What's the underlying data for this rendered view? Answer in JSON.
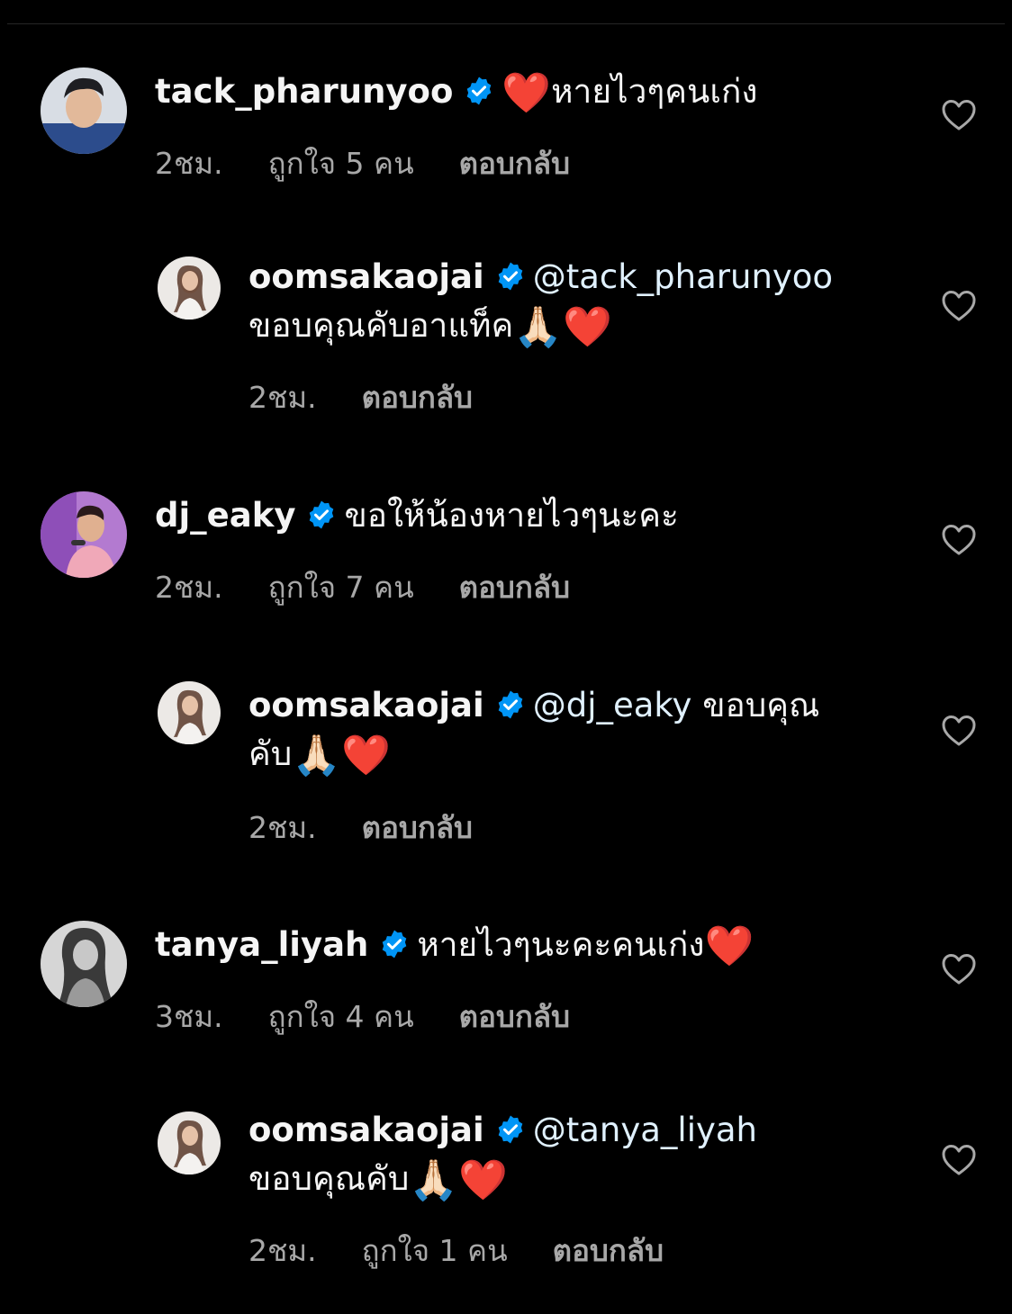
{
  "colors": {
    "background": "#000000",
    "text": "#f5f5f5",
    "muted": "#a8a8a8",
    "mention": "#e0f1ff",
    "verified": "#0095f6",
    "heart": "#e0162b"
  },
  "comments": [
    {
      "username": "tack_pharunyoo",
      "verified": true,
      "emoji_before": "❤️",
      "text": "หายไวๆคนเก่ง",
      "time": "2ชม.",
      "likes": "ถูกใจ 5 คน",
      "reply_label": "ตอบกลับ",
      "icon": "heart-outline-icon"
    },
    {
      "username": "oomsakaojai",
      "verified": true,
      "mention": "@tack_pharunyoo",
      "text": "ขอบคุณคับอาแท็ค",
      "emoji_after": "🙏🏻",
      "heart_after": "❤️",
      "time": "2ชม.",
      "reply_label": "ตอบกลับ",
      "icon": "heart-outline-icon"
    },
    {
      "username": "dj_eaky",
      "verified": true,
      "text": "ขอให้น้องหายไวๆนะคะ",
      "time": "2ชม.",
      "likes": "ถูกใจ 7 คน",
      "reply_label": "ตอบกลับ",
      "icon": "heart-outline-icon"
    },
    {
      "username": "oomsakaojai",
      "verified": true,
      "mention": "@dj_eaky",
      "text_line1": "ขอบคุณ",
      "text_line2": "คับ",
      "emoji_after": "🙏🏻",
      "heart_after": "❤️",
      "time": "2ชม.",
      "reply_label": "ตอบกลับ",
      "icon": "heart-outline-icon"
    },
    {
      "username": "tanya_liyah",
      "verified": true,
      "text": "หายไวๆนะคะคนเก่ง",
      "heart_after": "❤️",
      "time": "3ชม.",
      "likes": "ถูกใจ 4 คน",
      "reply_label": "ตอบกลับ",
      "icon": "heart-outline-icon"
    },
    {
      "username": "oomsakaojai",
      "verified": true,
      "mention": "@tanya_liyah",
      "text": "ขอบคุณคับ",
      "emoji_after": "🙏🏻",
      "heart_after": "❤️",
      "time": "2ชม.",
      "likes": "ถูกใจ 1 คน",
      "reply_label": "ตอบกลับ",
      "icon": "heart-outline-icon"
    }
  ]
}
